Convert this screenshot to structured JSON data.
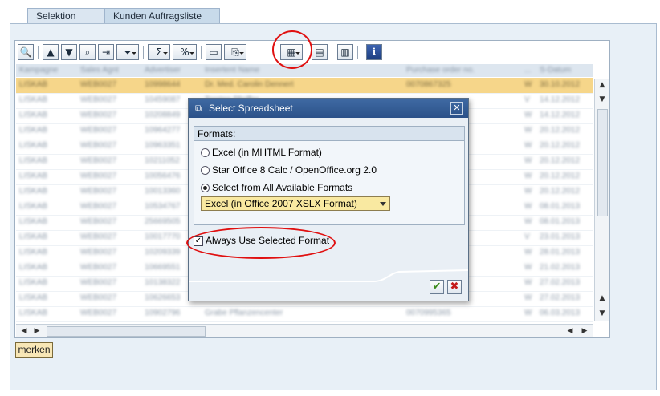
{
  "tabs": [
    "Selektion",
    "Kunden Auftragsliste"
  ],
  "toolbar": {
    "buttons": [
      {
        "name": "details-icon",
        "glyph": "🔍"
      },
      {
        "name": "sort-ascending-icon",
        "glyph": "▲"
      },
      {
        "name": "filter-icon",
        "glyph": "▼"
      },
      {
        "name": "find-icon",
        "glyph": "🔎"
      },
      {
        "name": "find-next-icon",
        "glyph": "⇥"
      },
      {
        "name": "set-filter-icon",
        "glyph": "⏷"
      },
      {
        "name": "sum-icon",
        "glyph": "Σ"
      },
      {
        "name": "subtotal-icon",
        "glyph": "%"
      },
      {
        "name": "print-preview-icon",
        "glyph": "🖶"
      },
      {
        "name": "export-icon",
        "glyph": "⤓"
      },
      {
        "name": "spreadsheet-icon",
        "glyph": "▦"
      },
      {
        "name": "local-file-icon",
        "glyph": "▤"
      },
      {
        "name": "layout-icon",
        "glyph": "▥"
      },
      {
        "name": "info-icon",
        "glyph": "i"
      }
    ]
  },
  "grid": {
    "columns": [
      "Kampagne",
      "Sales Agnt",
      "Advertiser",
      "Insertent Name",
      "Purchase order no.",
      "...",
      "S-Datum"
    ],
    "rows": [
      [
        "LISKAB",
        "WEB0027",
        "10998644",
        "Dr. Med. Carolin Dennert",
        "0070867325",
        "W",
        "30.10.2012"
      ],
      [
        "LISKAB",
        "WEB0027",
        "10459087",
        "Torsten Pfeiffer",
        "",
        "V",
        "14.12.2012"
      ],
      [
        "LISKAB",
        "WEB0027",
        "10208849",
        "",
        "",
        "W",
        "14.12.2012"
      ],
      [
        "LISKAB",
        "WEB0027",
        "10964277",
        "",
        "",
        "W",
        "20.12.2012"
      ],
      [
        "LISKAB",
        "WEB0027",
        "10963351",
        "",
        "",
        "W",
        "20.12.2012"
      ],
      [
        "LISKAB",
        "WEB0027",
        "10211052",
        "",
        "",
        "W",
        "20.12.2012"
      ],
      [
        "LISKAB",
        "WEB0027",
        "10056476",
        "",
        "",
        "W",
        "20.12.2012"
      ],
      [
        "LISKAB",
        "WEB0027",
        "10013360",
        "",
        "",
        "W",
        "20.12.2012"
      ],
      [
        "LISKAB",
        "WEB0027",
        "10534767",
        "",
        "",
        "W",
        "08.01.2013"
      ],
      [
        "LISKAB",
        "WEB0027",
        "25669505",
        "",
        "",
        "W",
        "08.01.2013"
      ],
      [
        "LISKAB",
        "WEB0027",
        "10017770",
        "",
        "",
        "V",
        "23.01.2013"
      ],
      [
        "LISKAB",
        "WEB0027",
        "10209339",
        "",
        "",
        "W",
        "28.01.2013"
      ],
      [
        "LISKAB",
        "WEB0027",
        "10669551",
        "",
        "",
        "W",
        "21.02.2013"
      ],
      [
        "LISKAB",
        "WEB0027",
        "10138322",
        "",
        "",
        "W",
        "27.02.2013"
      ],
      [
        "LISKAB",
        "WEB0027",
        "10626653",
        "",
        "",
        "W",
        "27.02.2013"
      ],
      [
        "LISKAB",
        "WEB0027",
        "10902796",
        "Grabe Pflanzencenter",
        "0070995365",
        "W",
        "06.03.2013"
      ]
    ]
  },
  "merken_label": "merken",
  "dialog": {
    "title": "Select Spreadsheet",
    "formats_header": "Formats:",
    "options": [
      {
        "label": "Excel (in MHTML Format)",
        "selected": false
      },
      {
        "label": "Star Office 8 Calc / OpenOffice.org 2.0",
        "selected": false
      },
      {
        "label": "Select from All Available Formats",
        "selected": true
      }
    ],
    "format_select_value": "Excel (in Office 2007 XSLX Format)",
    "always_use_label": "Always Use Selected Format",
    "always_use_checked": true,
    "ok_glyph": "✔",
    "cancel_glyph": "✖",
    "close_glyph": "✕"
  },
  "colors": {
    "annotation": "#e01010",
    "highlight_row": "#f6d68a",
    "dialog_title": "#2b5189"
  }
}
